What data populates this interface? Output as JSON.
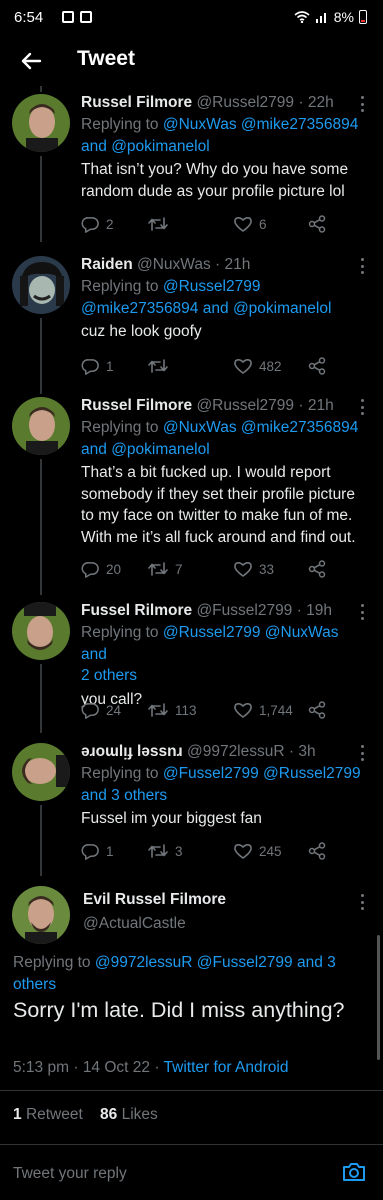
{
  "status_bar": {
    "time": "6:54",
    "battery": "8%"
  },
  "header": {
    "title": "Tweet"
  },
  "replies": [
    {
      "name": "Russel Filmore",
      "handle": "@Russel2799",
      "time": "22h",
      "replying_prefix": "Replying to",
      "replying_line1": "@NuxWas @mike27356894",
      "replying_and": "and",
      "replying_line2": "@pokimanelol",
      "text": "That isn’t you? Why do you have some random dude as your profile picture lol",
      "reply_count": "2",
      "retweet_count": "",
      "like_count": "6"
    },
    {
      "name": "Raiden",
      "handle": "@NuxWas",
      "time": "21h",
      "replying_prefix": "Replying to",
      "replying_line1": "@Russel2799",
      "replying_line2": "@mike27356894",
      "replying_and": "and",
      "replying_line2b": "@pokimanelol",
      "text": "cuz he look goofy",
      "reply_count": "1",
      "retweet_count": "",
      "like_count": "482"
    },
    {
      "name": "Russel Filmore",
      "handle": "@Russel2799",
      "time": "21h",
      "replying_prefix": "Replying to",
      "replying_line1": "@NuxWas @mike27356894",
      "replying_and": "and",
      "replying_line2": "@pokimanelol",
      "text": "That’s a bit fucked up. I would report somebody if they set their profile picture to my face on twitter to make fun of me. With me it’s all fuck around and find out.",
      "reply_count": "20",
      "retweet_count": "7",
      "like_count": "33"
    },
    {
      "name": "Fussel Rilmore",
      "handle": "@Fussel2799",
      "time": "19h",
      "replying_prefix": "Replying to",
      "replying_line1": "@Russel2799 @NuxWas",
      "replying_and": "and",
      "replying_line2": "2 others",
      "text": "you call?",
      "reply_count": "24",
      "retweet_count": "113",
      "like_count": "1,744"
    },
    {
      "name": "ǝɹoɯlᴉɟ lǝssnɹ",
      "handle": "@9972lessuR",
      "time": "3h",
      "replying_prefix": "Replying to",
      "replying_line1": "@Fussel2799 @Russel2799",
      "replying_line2": "and 3 others",
      "text": "Fussel im your biggest fan",
      "reply_count": "1",
      "retweet_count": "3",
      "like_count": "245"
    }
  ],
  "main_tweet": {
    "name": "Evil Russel Filmore",
    "handle": "@ActualCastle",
    "replying_prefix": "Replying to",
    "replying_mentions": "@9972lessuR @Fussel2799",
    "replying_and": "and 3",
    "replying_others": "others",
    "text": "Sorry I'm late. Did I miss anything?",
    "time": "5:13 pm",
    "date": "14 Oct 22",
    "source": "Twitter for Android",
    "retweets_count": "1",
    "retweets_label": "Retweet",
    "likes_count": "86",
    "likes_label": "Likes"
  },
  "reply_bar": {
    "placeholder": "Tweet your reply"
  },
  "colors": {
    "background": "#000000",
    "link": "#1d9bf0",
    "muted": "#71767b",
    "text": "#e7e9ea"
  },
  "icons": [
    "back-arrow-icon",
    "more-icon",
    "reply-icon",
    "retweet-icon",
    "like-icon",
    "share-icon",
    "camera-icon"
  ]
}
